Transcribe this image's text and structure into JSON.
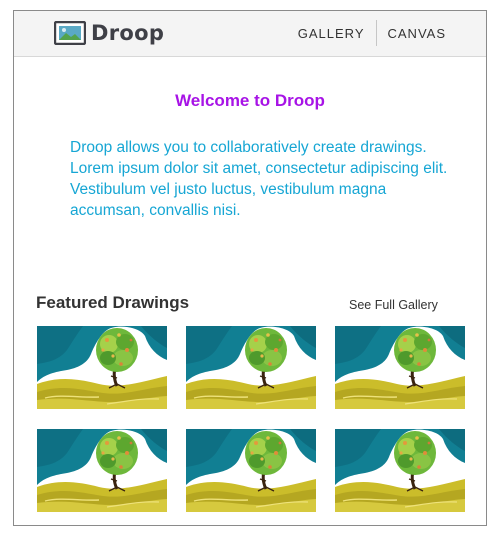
{
  "app": {
    "brand": "Droop",
    "nav": {
      "gallery_label": "GALLERY",
      "canvas_label": "CANVAS"
    }
  },
  "main": {
    "welcome": "Welcome to Droop",
    "intro": "Droop allows you to collaboratively create drawings. Lorem ipsum dolor sit amet, consectetur adipiscing elit. Vestibulum vel justo luctus, vestibulum magna accumsan, convallis nisi."
  },
  "featured": {
    "title": "Featured Drawings",
    "see_all_label": "See Full Gallery",
    "drawing_count": 6
  },
  "colors": {
    "welcome": "#a713e6",
    "intro_text": "#16a6d4",
    "navbar_bg": "#f4f4f4"
  },
  "icons": {
    "logo": "image-frame-icon"
  }
}
